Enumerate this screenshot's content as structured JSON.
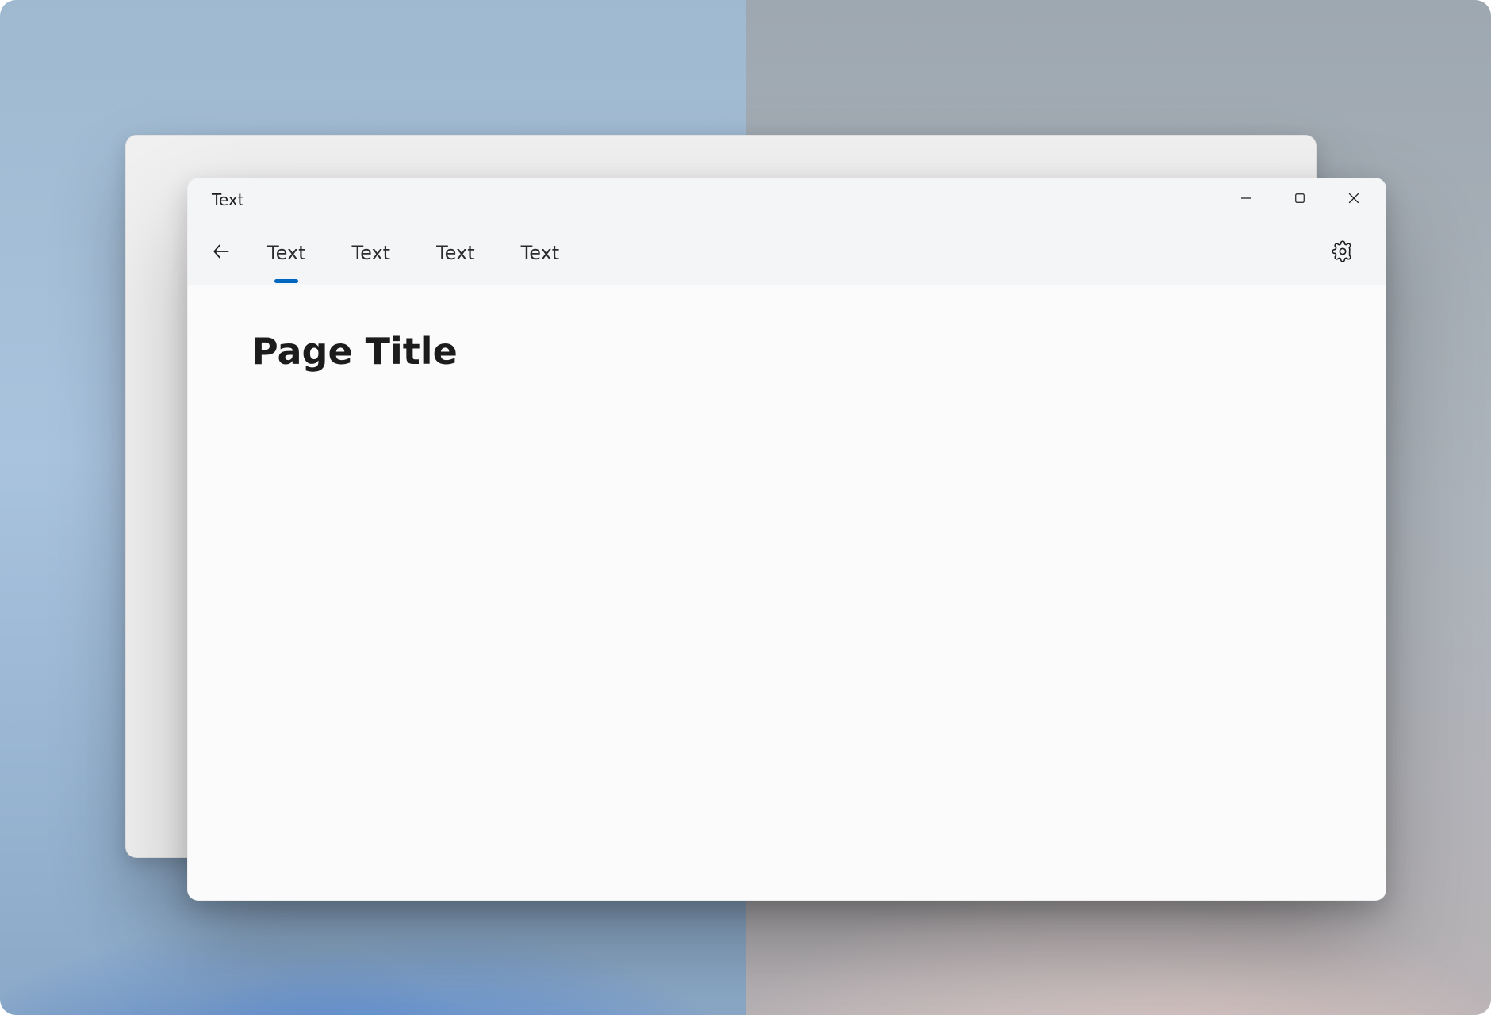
{
  "window": {
    "title": "Text",
    "tabs": [
      {
        "label": "Text",
        "active": true
      },
      {
        "label": "Text",
        "active": false
      },
      {
        "label": "Text",
        "active": false
      },
      {
        "label": "Text",
        "active": false
      }
    ]
  },
  "page": {
    "title": "Page Title"
  },
  "colors": {
    "accent": "#0067C0"
  }
}
